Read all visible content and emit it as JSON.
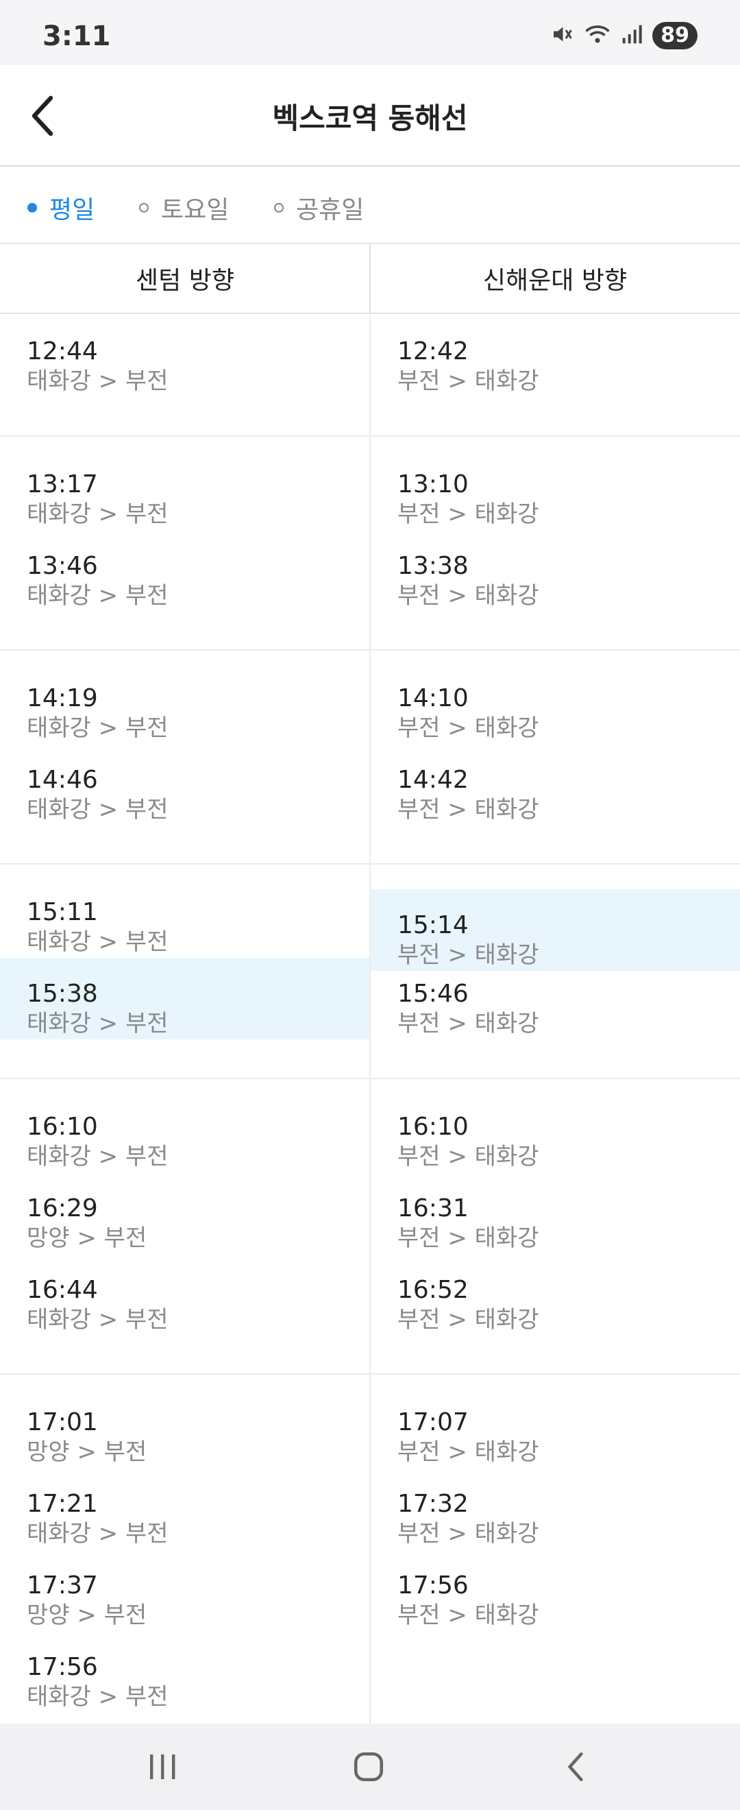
{
  "status_bar": {
    "time": "3:11",
    "battery": "89"
  },
  "header": {
    "title": "벡스코역 동해선"
  },
  "day_tabs": [
    {
      "label": "평일",
      "active": true
    },
    {
      "label": "토요일",
      "active": false
    },
    {
      "label": "공휴일",
      "active": false
    }
  ],
  "columns": [
    "센텀 방향",
    "신해운대 방향"
  ],
  "left": [
    {
      "time": "12:44",
      "route": "태화강 > 부전",
      "highlight": false
    },
    {
      "time": "13:17",
      "route": "태화강 > 부전",
      "highlight": false
    },
    {
      "time": "13:46",
      "route": "태화강 > 부전",
      "highlight": false
    },
    {
      "time": "14:19",
      "route": "태화강 > 부전",
      "highlight": false
    },
    {
      "time": "14:46",
      "route": "태화강 > 부전",
      "highlight": false
    },
    {
      "time": "15:11",
      "route": "태화강 > 부전",
      "highlight": false
    },
    {
      "time": "15:38",
      "route": "태화강 > 부전",
      "highlight": true
    },
    {
      "time": "16:10",
      "route": "태화강 > 부전",
      "highlight": false
    },
    {
      "time": "16:29",
      "route": "망양 > 부전",
      "highlight": false
    },
    {
      "time": "16:44",
      "route": "태화강 > 부전",
      "highlight": false
    },
    {
      "time": "17:01",
      "route": "망양 > 부전",
      "highlight": false
    },
    {
      "time": "17:21",
      "route": "태화강 > 부전",
      "highlight": false
    },
    {
      "time": "17:37",
      "route": "망양 > 부전",
      "highlight": false
    },
    {
      "time": "17:56",
      "route": "태화강 > 부전",
      "highlight": false
    }
  ],
  "right": [
    {
      "time": "12:42",
      "route": "부전 > 태화강",
      "highlight": false
    },
    {
      "time": "13:10",
      "route": "부전 > 태화강",
      "highlight": false
    },
    {
      "time": "13:38",
      "route": "부전 > 태화강",
      "highlight": false
    },
    {
      "time": "14:10",
      "route": "부전 > 태화강",
      "highlight": false
    },
    {
      "time": "14:42",
      "route": "부전 > 태화강",
      "highlight": false
    },
    {
      "time": "15:14",
      "route": "부전 > 태화강",
      "highlight": true
    },
    {
      "time": "15:46",
      "route": "부전 > 태화강",
      "highlight": false
    },
    {
      "time": "16:10",
      "route": "부전 > 태화강",
      "highlight": false
    },
    {
      "time": "16:31",
      "route": "부전 > 태화강",
      "highlight": false
    },
    {
      "time": "16:52",
      "route": "부전 > 태화강",
      "highlight": false
    },
    {
      "time": "17:07",
      "route": "부전 > 태화강",
      "highlight": false
    },
    {
      "time": "17:32",
      "route": "부전 > 태화강",
      "highlight": false
    },
    {
      "time": "17:56",
      "route": "부전 > 태화강",
      "highlight": false
    }
  ]
}
